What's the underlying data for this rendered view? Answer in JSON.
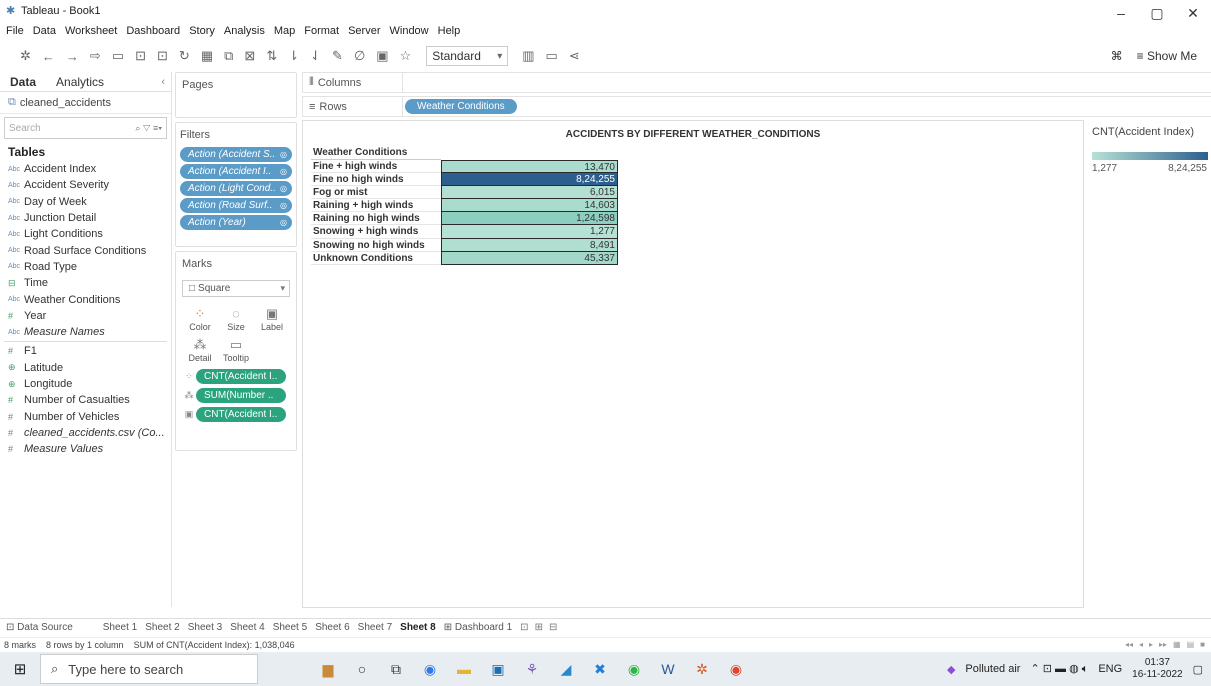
{
  "window": {
    "title": "Tableau - Book1",
    "minimize": "–",
    "maximize": "▢",
    "close": "✕"
  },
  "menu": [
    "File",
    "Data",
    "Worksheet",
    "Dashboard",
    "Story",
    "Analysis",
    "Map",
    "Format",
    "Server",
    "Window",
    "Help"
  ],
  "toolbar": {
    "fit_select": "Standard",
    "show_me": "Show Me"
  },
  "data_pane": {
    "tab_data": "Data",
    "tab_analytics": "Analytics",
    "datasource": "cleaned_accidents",
    "search_placeholder": "Search",
    "tables_header": "Tables",
    "fields": [
      {
        "label": "Accident Index",
        "type": "Abc"
      },
      {
        "label": "Accident Severity",
        "type": "Abc"
      },
      {
        "label": "Day of Week",
        "type": "Abc"
      },
      {
        "label": "Junction Detail",
        "type": "Abc"
      },
      {
        "label": "Light Conditions",
        "type": "Abc"
      },
      {
        "label": "Road Surface Conditions",
        "type": "Abc"
      },
      {
        "label": "Road Type",
        "type": "Abc"
      },
      {
        "label": "Time",
        "type": "⊟"
      },
      {
        "label": "Weather Conditions",
        "type": "Abc"
      },
      {
        "label": "Year",
        "type": "#"
      },
      {
        "label": "Measure Names",
        "type": "Abc"
      }
    ],
    "measures": [
      {
        "label": "F1",
        "type": "#"
      },
      {
        "label": "Latitude",
        "type": "⊕"
      },
      {
        "label": "Longitude",
        "type": "⊕"
      },
      {
        "label": "Number of Casualties",
        "type": "#"
      },
      {
        "label": "Number of Vehicles",
        "type": "#"
      },
      {
        "label": "cleaned_accidents.csv (Co...",
        "type": "#"
      },
      {
        "label": "Measure Values",
        "type": "#"
      }
    ]
  },
  "shelves": {
    "pages_title": "Pages",
    "filters_title": "Filters",
    "filters": [
      "Action (Accident S..",
      "Action (Accident I..",
      "Action (Light Cond..",
      "Action (Road Surf..",
      "Action (Year)"
    ],
    "marks_title": "Marks",
    "mark_type": "Square",
    "mark_buttons": [
      "Color",
      "Size",
      "Label",
      "Detail",
      "Tooltip"
    ],
    "mark_pills": [
      "CNT(Accident I..",
      "SUM(Number ..",
      "CNT(Accident I.."
    ],
    "columns_label": "Columns",
    "rows_label": "Rows",
    "rows_pill": "Weather Conditions"
  },
  "view": {
    "title": "ACCIDENTS BY DIFFERENT WEATHER_CONDITIONS",
    "header": "Weather Conditions",
    "rows": [
      {
        "label": "Fine + high winds",
        "value": "13,470",
        "color": "#a9dccd"
      },
      {
        "label": "Fine no high winds",
        "value": "8,24,255",
        "color": "#2d5f8e"
      },
      {
        "label": "Fog or mist",
        "value": "6,015",
        "color": "#b3e0d3"
      },
      {
        "label": "Raining + high winds",
        "value": "14,603",
        "color": "#a9dccd"
      },
      {
        "label": "Raining no high winds",
        "value": "1,24,598",
        "color": "#8ccfc0"
      },
      {
        "label": "Snowing + high winds",
        "value": "1,277",
        "color": "#b6e2d5"
      },
      {
        "label": "Snowing no high winds",
        "value": "8,491",
        "color": "#b0dfd1"
      },
      {
        "label": "Unknown Conditions",
        "value": "45,337",
        "color": "#a1d8c9"
      }
    ]
  },
  "legend": {
    "title": "CNT(Accident Index)",
    "min": "1,277",
    "max": "8,24,255",
    "color_min": "#b6e2d5",
    "color_max": "#2d5f8e"
  },
  "sheet_tabs": {
    "datasource": "Data Source",
    "sheets": [
      "Sheet 1",
      "Sheet 2",
      "Sheet 3",
      "Sheet 4",
      "Sheet 5",
      "Sheet 6",
      "Sheet 7",
      "Sheet 8",
      "Dashboard 1"
    ],
    "active": "Sheet 8"
  },
  "status": {
    "marks": "8 marks",
    "rows": "8 rows by 1 column",
    "sum": "SUM of CNT(Accident Index): 1,038,046"
  },
  "taskbar": {
    "search_placeholder": "Type here to search",
    "weather": "Polluted air",
    "lang": "ENG",
    "time": "01:37",
    "date": "16-11-2022"
  }
}
